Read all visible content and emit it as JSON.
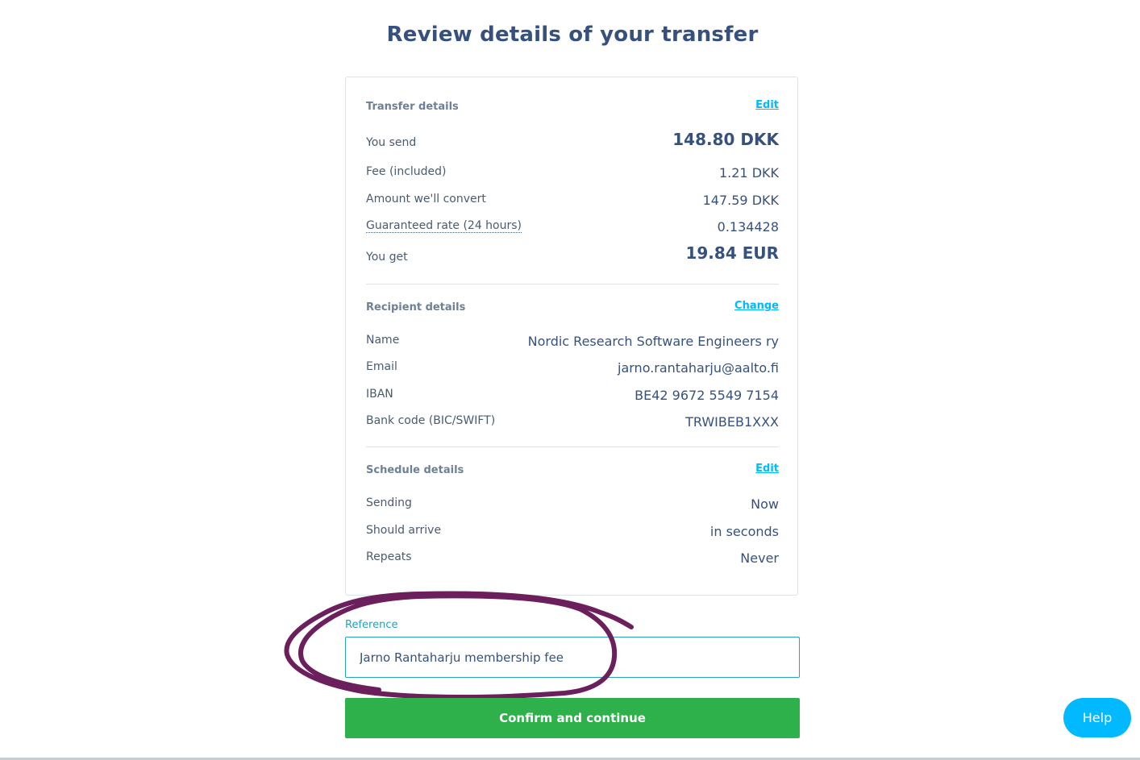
{
  "page": {
    "title": "Review details of your transfer"
  },
  "transfer": {
    "heading": "Transfer details",
    "edit_label": "Edit",
    "rows": [
      {
        "label": "You send",
        "value": "148.80 DKK"
      },
      {
        "label": "Fee (included)",
        "value": "1.21 DKK"
      },
      {
        "label": "Amount we'll convert",
        "value": "147.59 DKK"
      },
      {
        "label": "Guaranteed rate (24 hours)",
        "value": "0.134428"
      },
      {
        "label": "You get",
        "value": "19.84 EUR"
      }
    ]
  },
  "recipient": {
    "heading": "Recipient details",
    "change_label": "Change",
    "rows": [
      {
        "label": "Name",
        "value": "Nordic Research Software Engineers ry"
      },
      {
        "label": "Email",
        "value": "jarno.rantaharju@aalto.fi"
      },
      {
        "label": "IBAN",
        "value": "BE42 9672 5549 7154"
      },
      {
        "label": "Bank code (BIC/SWIFT)",
        "value": "TRWIBEB1XXX"
      }
    ]
  },
  "schedule": {
    "heading": "Schedule details",
    "edit_label": "Edit",
    "rows": [
      {
        "label": "Sending",
        "value": "Now"
      },
      {
        "label": "Should arrive",
        "value": "in seconds"
      },
      {
        "label": "Repeats",
        "value": "Never"
      }
    ]
  },
  "reference": {
    "label": "Reference",
    "value": "Jarno Rantaharju membership fee"
  },
  "actions": {
    "confirm_label": "Confirm and continue",
    "help_label": "Help"
  },
  "colors": {
    "title": "#37517e",
    "link": "#00b9ff",
    "confirm": "#2eb04a",
    "annotation": "#6b1f5c"
  }
}
